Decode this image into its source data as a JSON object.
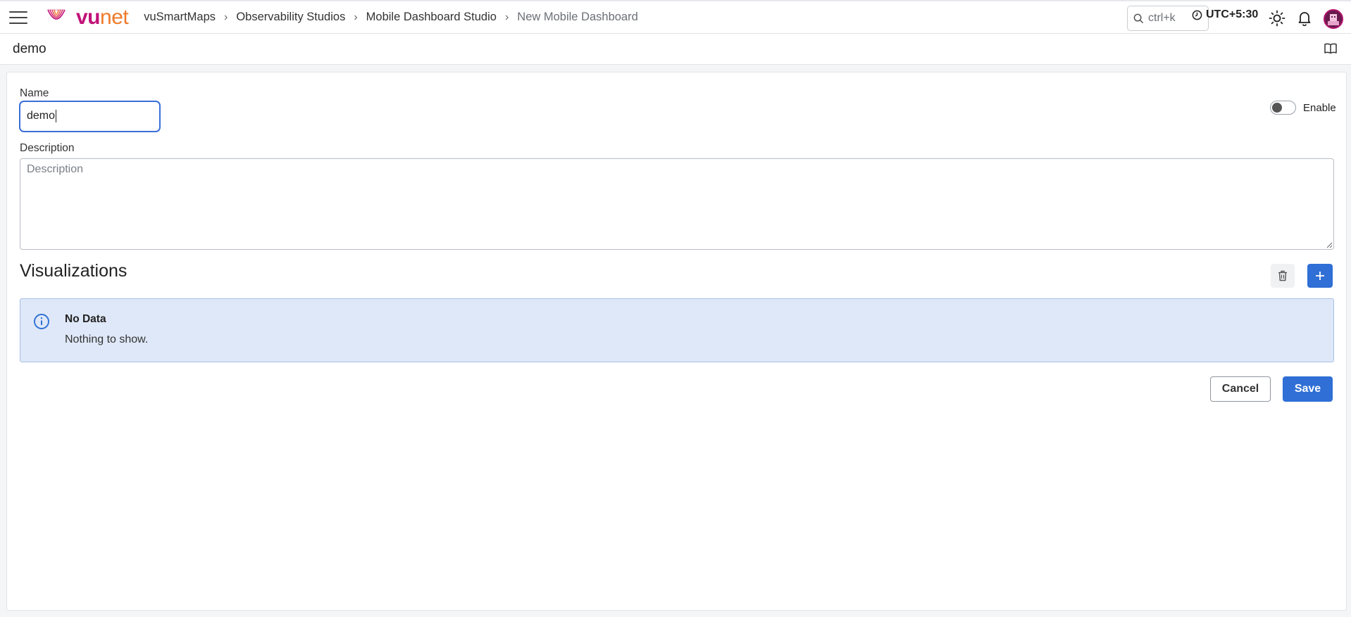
{
  "app": {
    "logo_text_vu": "vu",
    "logo_text_net": "net"
  },
  "breadcrumb": [
    {
      "label": "vuSmartMaps"
    },
    {
      "label": "Observability Studios"
    },
    {
      "label": "Mobile Dashboard Studio"
    },
    {
      "label": "New Mobile Dashboard"
    }
  ],
  "header": {
    "search_placeholder": "ctrl+k",
    "timezone": "UTC+5:30"
  },
  "page": {
    "title": "demo"
  },
  "form": {
    "name_label": "Name",
    "name_value": "demo",
    "enable_label": "Enable",
    "enable_on": false,
    "description_label": "Description",
    "description_placeholder": "Description",
    "description_value": ""
  },
  "visualizations": {
    "title": "Visualizations",
    "add_label": "+",
    "empty_title": "No Data",
    "empty_message": "Nothing to show."
  },
  "actions": {
    "cancel_label": "Cancel",
    "save_label": "Save"
  },
  "colors": {
    "primary": "#2f6fd6",
    "brand_magenta": "#c2127a",
    "brand_orange": "#ef7a2a",
    "info_bg": "#dfe8f8"
  }
}
